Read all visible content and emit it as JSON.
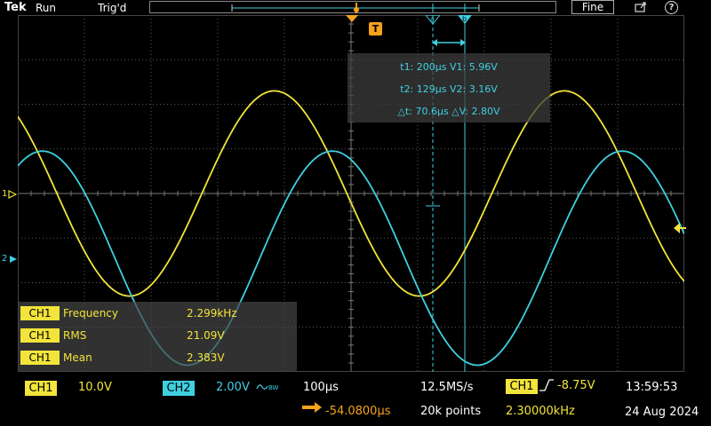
{
  "header": {
    "brand": "Tek",
    "acq_state": "Run",
    "trigger_state": "Trig'd",
    "resolution_button": "Fine",
    "help_label": "?"
  },
  "markers": {
    "trigger_marker": "T",
    "cursor_a": "a",
    "cursor_b": "b",
    "ch1_ref": "1",
    "ch2_ref": "2"
  },
  "cursor_readout": {
    "line1": "t1: 200µs  V1: 5.96V",
    "line2": "t2: 129µs  V2: 3.16V",
    "line3": "△t: 70.6µs  △V: 2.80V"
  },
  "measurements": [
    {
      "channel": "CH1",
      "name": "Frequency",
      "value": "2.299kHz"
    },
    {
      "channel": "CH1",
      "name": "RMS",
      "value": "21.09V"
    },
    {
      "channel": "CH1",
      "name": "Mean",
      "value": "2.383V"
    }
  ],
  "bottom": {
    "ch1_label": "CH1",
    "ch1_scale": "10.0V",
    "ch2_label": "CH2",
    "ch2_scale": "2.00V",
    "bw_label": "BW",
    "timebase": "100µs",
    "sample_rate": "12.5MS/s",
    "trigger_source": "CH1",
    "trigger_level": "-8.75V",
    "time": "13:59:53",
    "position": "-54.0800µs",
    "record_length": "20k points",
    "trigger_freq": "2.30000kHz",
    "date": "24 Aug 2024"
  },
  "colors": {
    "ch1": "#f2e43a",
    "ch2": "#3fd0e0",
    "trigger": "#f7a21b",
    "grid": "#5a5a5a"
  },
  "chart_data": {
    "type": "line",
    "xlabel": "",
    "ylabel": "",
    "grid": true,
    "series": [
      {
        "name": "CH1",
        "waveform": "sine",
        "frequency_khz": 2.299,
        "peak_divisions": 2.3,
        "offset_divisions": 0,
        "color": "#f2e43a"
      },
      {
        "name": "CH2",
        "waveform": "sine",
        "frequency_khz": 2.299,
        "peak_divisions": 2.4,
        "offset_divisions": -1.45,
        "color": "#3fd0e0"
      }
    ],
    "horizontal_divisions": 10,
    "vertical_divisions": 8,
    "time_per_division_us": 100
  }
}
